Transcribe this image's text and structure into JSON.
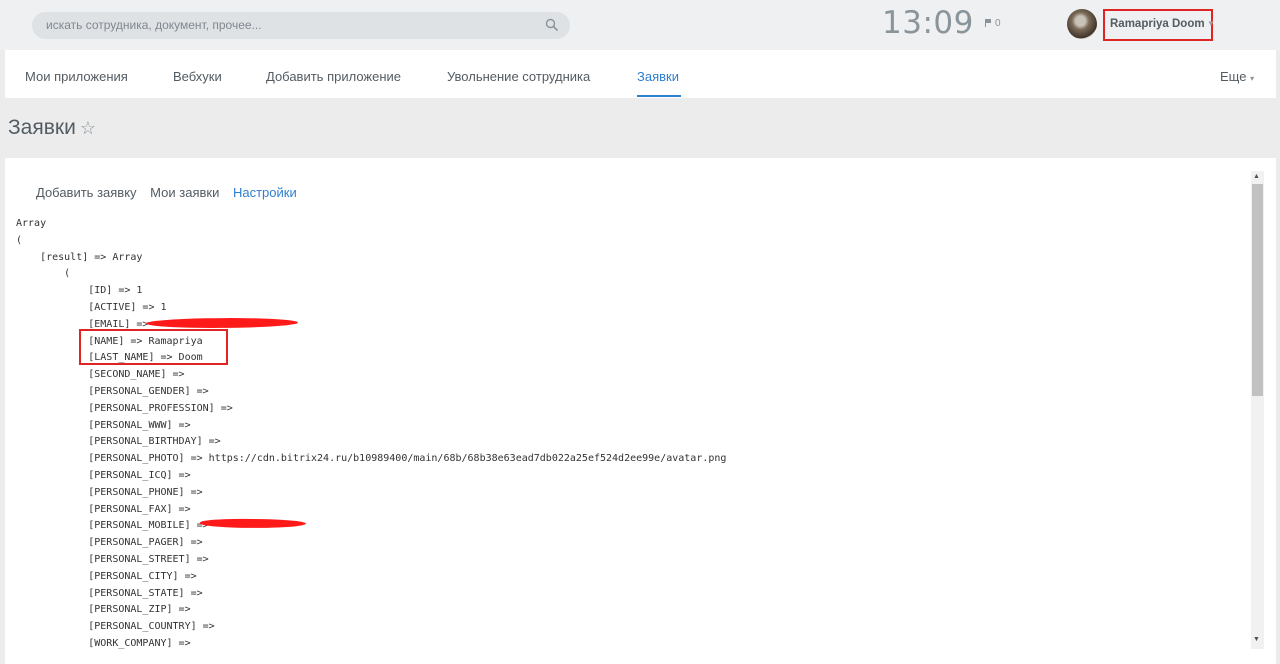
{
  "search": {
    "placeholder": "искать сотрудника, документ, прочее..."
  },
  "header": {
    "clock": "13:09",
    "flag_count": "0",
    "user_name": "Ramapriya Doom"
  },
  "nav": {
    "items": [
      "Мои приложения",
      "Вебхуки",
      "Добавить приложение",
      "Увольнение сотрудника",
      "Заявки"
    ],
    "active": "Заявки",
    "more": "Еще"
  },
  "page": {
    "title": "Заявки"
  },
  "submenu": {
    "add": "Добавить заявку",
    "mine": "Мои заявки",
    "settings": "Настройки"
  },
  "dump": {
    "lines": [
      "Array",
      "(",
      "    [result] => Array",
      "        (",
      "            [ID] => 1",
      "            [ACTIVE] => 1",
      "            [EMAIL] => ",
      "            [NAME] => Ramapriya",
      "            [LAST_NAME] => Doom",
      "            [SECOND_NAME] =>",
      "            [PERSONAL_GENDER] =>",
      "            [PERSONAL_PROFESSION] =>",
      "            [PERSONAL_WWW] =>",
      "            [PERSONAL_BIRTHDAY] =>",
      "            [PERSONAL_PHOTO] => https://cdn.bitrix24.ru/b10989400/main/68b/68b38e63ead7db022a25ef524d2ee99e/avatar.png",
      "            [PERSONAL_ICQ] =>",
      "            [PERSONAL_PHONE] =>",
      "            [PERSONAL_FAX] =>",
      "            [PERSONAL_MOBILE] =>",
      "            [PERSONAL_PAGER] =>",
      "            [PERSONAL_STREET] =>",
      "            [PERSONAL_CITY] =>",
      "            [PERSONAL_STATE] =>",
      "            [PERSONAL_ZIP] =>",
      "            [PERSONAL_COUNTRY] =>",
      "            [WORK_COMPANY] =>"
    ]
  },
  "colors": {
    "accent": "#2f7fd0",
    "highlight": "#e02424",
    "redaction": "#ff1a1a"
  }
}
